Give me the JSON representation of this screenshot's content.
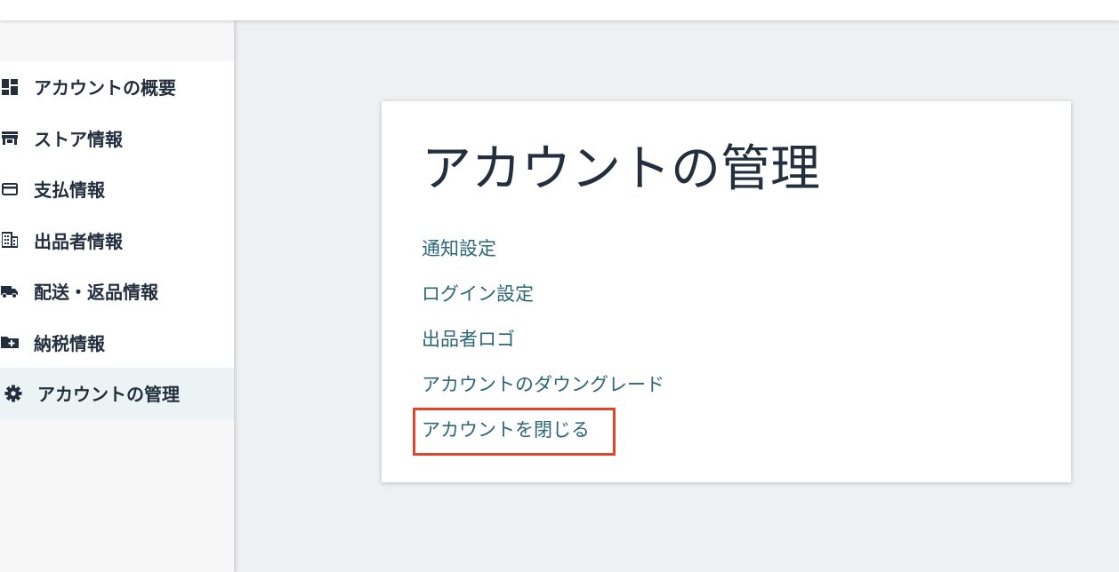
{
  "sidebar": {
    "items": [
      {
        "label": "アカウントの概要",
        "icon": "dashboard-icon",
        "active": false
      },
      {
        "label": "ストア情報",
        "icon": "store-icon",
        "active": false
      },
      {
        "label": "支払情報",
        "icon": "credit-card-icon",
        "active": false
      },
      {
        "label": "出品者情報",
        "icon": "building-icon",
        "active": false
      },
      {
        "label": "配送・返品情報",
        "icon": "truck-icon",
        "active": false
      },
      {
        "label": "納税情報",
        "icon": "folder-plus-icon",
        "active": false
      },
      {
        "label": "アカウントの管理",
        "icon": "gear-icon",
        "active": true
      }
    ]
  },
  "main": {
    "title": "アカウントの管理",
    "links": [
      {
        "label": "通知設定"
      },
      {
        "label": "ログイン設定"
      },
      {
        "label": "出品者ロゴ"
      },
      {
        "label": "アカウントのダウングレード"
      },
      {
        "label": "アカウントを閉じる",
        "highlighted": true
      }
    ]
  },
  "colors": {
    "link": "#2d6677",
    "text": "#232f3e",
    "highlight": "#e0452a",
    "active_bg": "#ecf3f5",
    "page_bg": "#eff0f2"
  }
}
